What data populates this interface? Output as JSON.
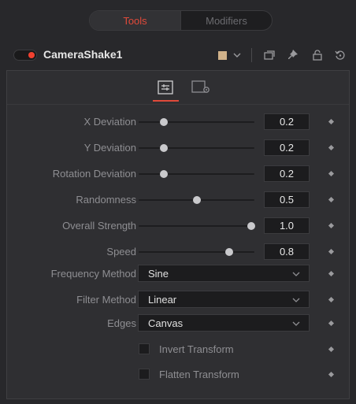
{
  "tabs": {
    "tools": "Tools",
    "modifiers": "Modifiers"
  },
  "header": {
    "tool_name": "CameraShake1",
    "swatch_color": "#d1b28a",
    "active_color": "#f24130"
  },
  "inspector": {
    "sliders": [
      {
        "label": "X Deviation",
        "value": "0.2",
        "position": 0.2
      },
      {
        "label": "Y Deviation",
        "value": "0.2",
        "position": 0.2
      },
      {
        "label": "Rotation Deviation",
        "value": "0.2",
        "position": 0.2
      },
      {
        "label": "Randomness",
        "value": "0.5",
        "position": 0.5
      },
      {
        "label": "Overall Strength",
        "value": "1.0",
        "position": 1.0
      },
      {
        "label": "Speed",
        "value": "0.8",
        "position": 0.8
      }
    ],
    "dropdowns": [
      {
        "label": "Frequency Method",
        "value": "Sine"
      },
      {
        "label": "Filter Method",
        "value": "Linear"
      },
      {
        "label": "Edges",
        "value": "Canvas"
      }
    ],
    "checkboxes": [
      {
        "label": "Invert Transform",
        "checked": false
      },
      {
        "label": "Flatten Transform",
        "checked": false
      }
    ]
  }
}
